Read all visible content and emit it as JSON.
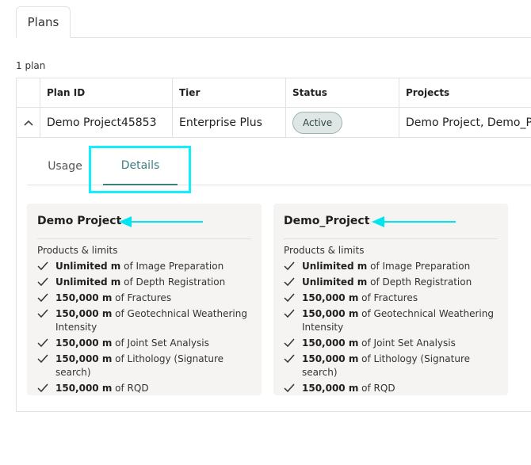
{
  "tabs": {
    "plans": "Plans"
  },
  "plan_count": "1 plan",
  "table": {
    "headers": [
      "Plan ID",
      "Tier",
      "Status",
      "Projects"
    ],
    "row": {
      "plan_id": "Demo Project45853",
      "tier": "Enterprise Plus",
      "status": "Active",
      "projects": "Demo Project, Demo_Proje"
    }
  },
  "detail_tabs": {
    "usage": "Usage",
    "details": "Details"
  },
  "cards": [
    {
      "title": "Demo Project",
      "subtitle": "Products & limits",
      "items": [
        {
          "amount": "Unlimited m",
          "rest": " of Image Preparation"
        },
        {
          "amount": "Unlimited m",
          "rest": " of Depth Registration"
        },
        {
          "amount": "150,000 m",
          "rest": " of Fractures"
        },
        {
          "amount": "150,000 m",
          "rest": " of Geotechnical Weathering Intensity"
        },
        {
          "amount": "150,000 m",
          "rest": " of Joint Set Analysis"
        },
        {
          "amount": "150,000 m",
          "rest": " of Lithology (Signature search)"
        },
        {
          "amount": "150,000 m",
          "rest": " of RQD"
        }
      ]
    },
    {
      "title": "Demo_Project",
      "subtitle": "Products & limits",
      "items": [
        {
          "amount": "Unlimited m",
          "rest": " of Image Preparation"
        },
        {
          "amount": "Unlimited m",
          "rest": " of Depth Registration"
        },
        {
          "amount": "150,000 m",
          "rest": " of Fractures"
        },
        {
          "amount": "150,000 m",
          "rest": " of Geotechnical Weathering Intensity"
        },
        {
          "amount": "150,000 m",
          "rest": " of Joint Set Analysis"
        },
        {
          "amount": "150,000 m",
          "rest": " of Lithology (Signature search)"
        },
        {
          "amount": "150,000 m",
          "rest": " of RQD"
        }
      ]
    }
  ],
  "colors": {
    "accent": "#3d7f80",
    "annotation": "#00e5f0",
    "card_bg": "#f5f4f2"
  },
  "icons": {
    "expand": "chevron-up-icon",
    "check": "check-icon",
    "annotation": "arrow-left-icon"
  }
}
